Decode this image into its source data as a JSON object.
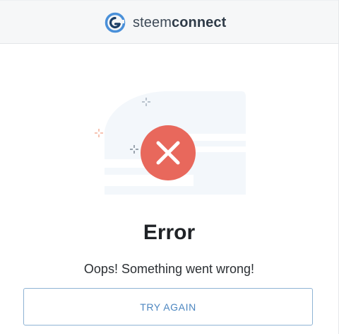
{
  "header": {
    "brand_light": "steem",
    "brand_bold": "connect",
    "logo_icon": "steemconnect-logo-icon"
  },
  "illustration": {
    "icon": "error-x-icon",
    "accent_color": "#e8685c",
    "sparkle_colors": [
      "#9aa7b4",
      "#f0a58a"
    ]
  },
  "main": {
    "title": "Error",
    "message": "Oops! Something went wrong!",
    "button_label": "TRY AGAIN"
  },
  "colors": {
    "button_text": "#4c86c0",
    "button_border": "#8fb3d4",
    "header_bg": "#f6f7f8"
  }
}
